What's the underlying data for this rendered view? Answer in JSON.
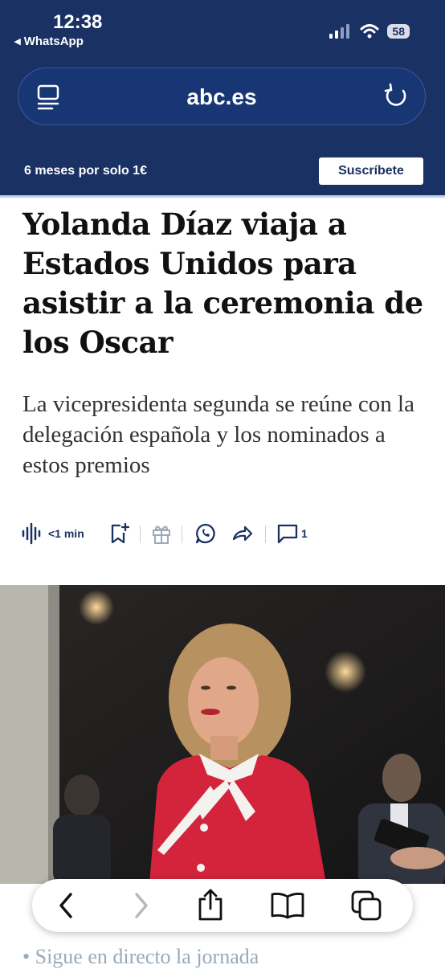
{
  "status": {
    "time": "12:38",
    "back_app": "◂ WhatsApp",
    "battery": "58"
  },
  "browser": {
    "url": "abc.es"
  },
  "promo": {
    "text": "6 meses por solo 1€",
    "subscribe_label": "Suscríbete"
  },
  "article": {
    "headline": "Yolanda Díaz viaja a Estados Unidos para asistir a la ceremonia de los Oscar",
    "subhead": "La vicepresidenta segunda se reúne con la delegación española y los nominados a estos premios",
    "read_time": "<1 min",
    "comment_count": "1",
    "next_text": "• Sigue en directo la jornada"
  },
  "colors": {
    "brand_navy": "#1a3163",
    "accent_red": "#d3243c"
  },
  "icons": [
    "reader-icon",
    "reload-icon",
    "audio-waveform-icon",
    "bookmark-add-icon",
    "gift-icon",
    "whatsapp-icon",
    "share-arrow-icon",
    "comment-icon",
    "back-chevron-icon",
    "forward-chevron-icon",
    "share-icon",
    "bookmarks-icon",
    "tabs-icon"
  ]
}
